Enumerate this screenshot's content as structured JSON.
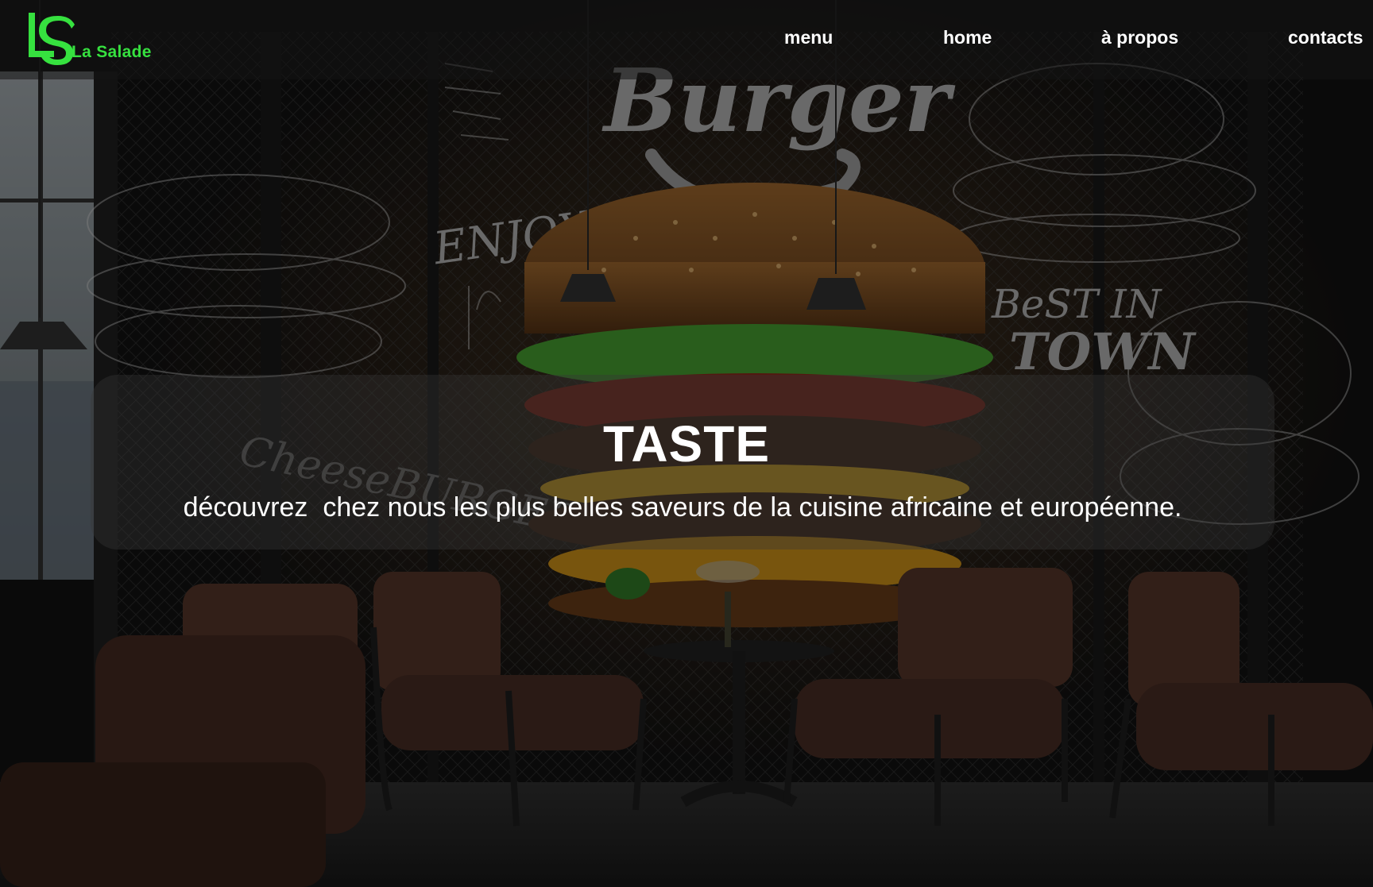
{
  "brand": {
    "mark": "LS",
    "name": "La Salade",
    "color": "#36e13f"
  },
  "nav": {
    "items": [
      {
        "label": "menu"
      },
      {
        "label": "home"
      },
      {
        "label": "à propos"
      },
      {
        "label": "contacts"
      }
    ]
  },
  "hero": {
    "title": "TASTE",
    "subtitle": "découvrez  chez nous les plus belles saveurs de la cuisine africaine et européenne."
  },
  "mural": {
    "burger_word": "Burger",
    "enjoy_word": "ENJOY",
    "best_word": "BeST IN",
    "town_word": "TOWN",
    "cheese_word": "CheeseBURGER"
  }
}
